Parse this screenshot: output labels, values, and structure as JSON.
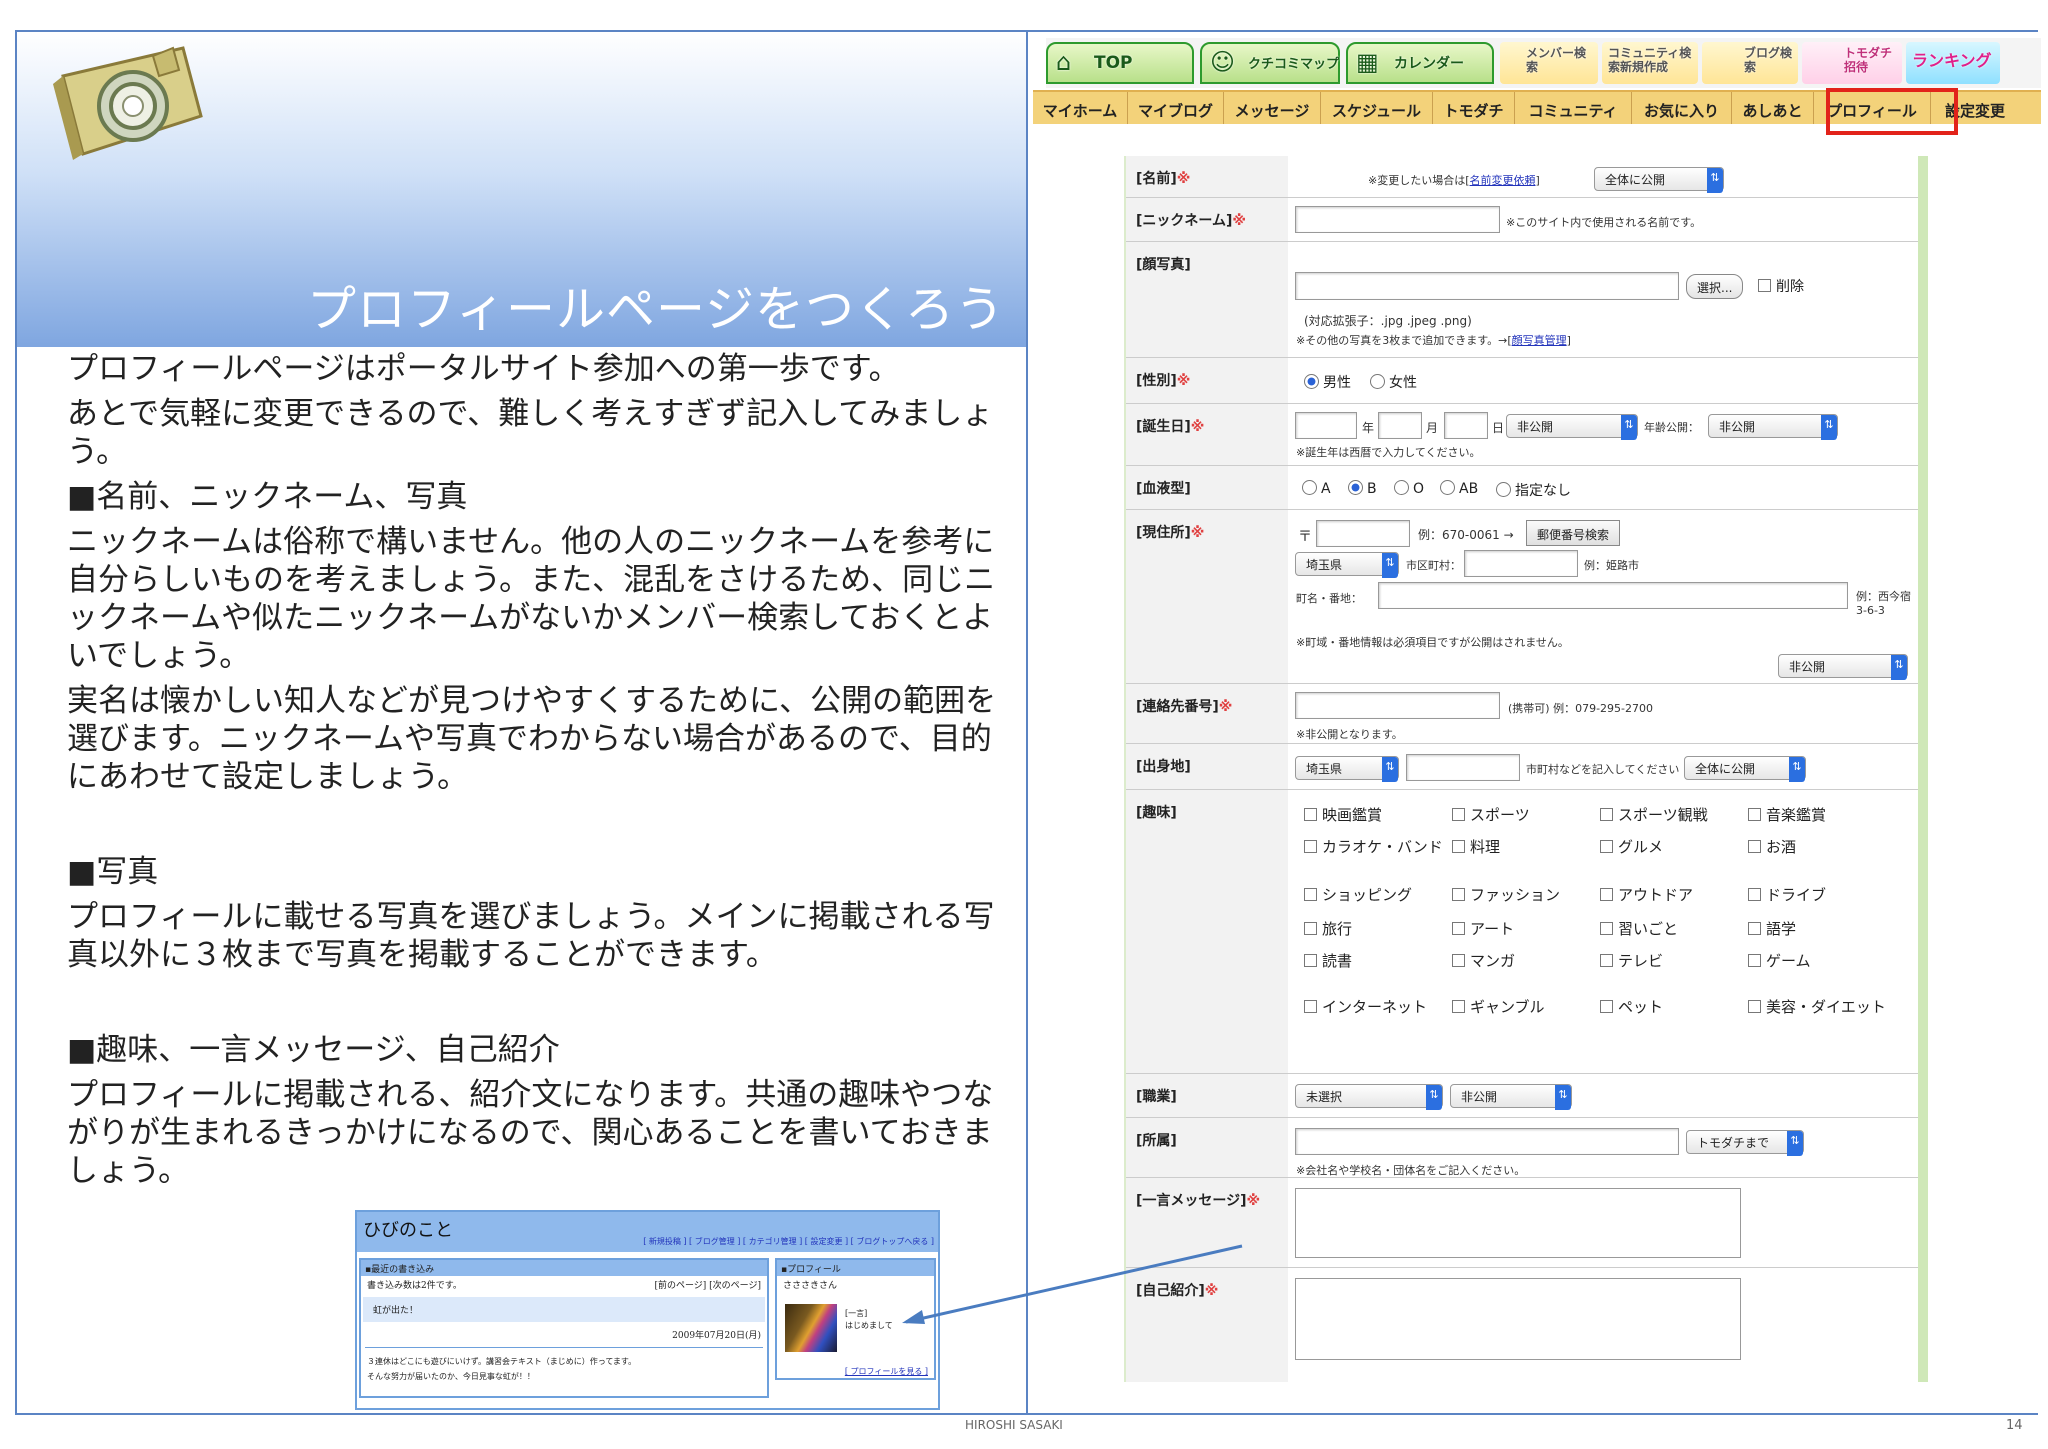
{
  "slide": {
    "title": "プロフィールページをつくろう",
    "page_number": "14",
    "footer": "HIROSHI SASAKI"
  },
  "body": {
    "p1": "プロフィールページはポータルサイト参加への第一歩です。",
    "p2": "あとで気軽に変更できるので、難しく考えすぎず記入してみましょう。",
    "h1": "■名前、ニックネーム、写真",
    "p3": "ニックネームは俗称で構いません。他の人のニックネームを参考に自分らしいものを考えましょう。また、混乱をさけるため、同じニックネームや似たニックネームがないかメンバー検索しておくとよいでしょう。",
    "p4": "実名は懐かしい知人などが見つけやすくするために、公開の範囲を選びます。ニックネームや写真でわからない場合があるので、目的にあわせて設定しましょう。",
    "h2": "■写真",
    "p5": "プロフィールに載せる写真を選びましょう。メインに掲載される写真以外に３枚まで写真を掲載することができます。",
    "h3": "■趣味、一言メッセージ、自己紹介",
    "p6": "プロフィールに掲載される、紹介文になります。共通の趣味やつながりが生まれるきっかけになるので、関心あることを書いておきましょう。"
  },
  "mini": {
    "title": "ひびのこと",
    "links": "[ 新規投稿 ] [ ブログ管理 ] [ カテゴリ管理 ] [ 設定変更 ] [ ブログトップへ戻る ]",
    "recent_header": "▪最近の書き込み",
    "count_text": "書き込み数は2件です。",
    "pager": "[前のページ] [次のページ]",
    "entry_title": "虹が出た！",
    "entry_date": "2009年07月20日(月)",
    "entry_body1": "３連休はどこにも遊びにいけず。講習会テキスト（まじめに）作ってます。",
    "entry_body2": "そんな努力が届いたのか、今日見事な虹が！！",
    "profile_header": "▪プロフィール",
    "profile_name": "さささきさん",
    "profile_msg1": "[一言]",
    "profile_msg2": "はじめまして",
    "profile_link": "[ プロフィールを見る ]"
  },
  "topnav": [
    {
      "label": "TOP",
      "icon": "house-icon"
    },
    {
      "label": "クチコミマップ",
      "icon": "map-icon"
    },
    {
      "label": "カレンダー",
      "icon": "calendar-icon"
    },
    {
      "label": "メンバー検索",
      "icon": "member-icon"
    },
    {
      "label": "コミュニティ検索新規作成",
      "icon": "community-icon"
    },
    {
      "label": "ブログ検索",
      "icon": "blog-icon"
    },
    {
      "label": "トモダチ招待",
      "icon": "invite-icon"
    },
    {
      "label": "ランキング",
      "icon": "ranking-icon"
    }
  ],
  "subnav": [
    "マイホーム",
    "マイブログ",
    "メッセージ",
    "スケジュール",
    "トモダチ",
    "コミュニティ",
    "お気に入り",
    "あしあと",
    "プロフィール",
    "設定変更"
  ],
  "form": {
    "name": {
      "label": "[名前]",
      "note": "※変更したい場合は[",
      "link": "名前変更依頼",
      "note_end": "]",
      "visibility": "全体に公開"
    },
    "nickname": {
      "label": "[ニックネーム]",
      "note": "※このサイト内で使用される名前です。"
    },
    "photo": {
      "label": "[顔写真]",
      "choose": "選択...",
      "delete": "削除",
      "ext": "(対応拡張子：.jpg .jpeg .png)",
      "more": "※その他の写真を3枚まで追加できます。→[",
      "more_link": "顔写真管理",
      "more_end": "]"
    },
    "gender": {
      "label": "[性別]",
      "options": [
        "男性",
        "女性"
      ],
      "selected": "男性"
    },
    "birthday": {
      "label": "[誕生日]",
      "year": "年",
      "month": "月",
      "day": "日",
      "visibility": "非公開",
      "age_label": "年齢公開：",
      "age_visibility": "非公開",
      "note": "※誕生年は西暦で入力してください。"
    },
    "blood": {
      "label": "[血液型]",
      "options": [
        "A",
        "B",
        "O",
        "AB",
        "指定なし"
      ],
      "selected": "B"
    },
    "address": {
      "label": "[現住所]",
      "postal_mark": "〒",
      "postal_example": "例：670-0061 →",
      "postal_button": "郵便番号検索",
      "prefecture": "埼玉県",
      "city_label": "市区町村：",
      "city_example": "例：姫路市",
      "town_label": "町名・番地：",
      "town_example": "例：西今宿3-6-3",
      "note": "※町域・番地情報は必須項目ですが公開はされません。",
      "visibility": "非公開"
    },
    "phone": {
      "label": "[連絡先番号]",
      "example": "(携帯可) 例：079-295-2700",
      "note": "※非公開となります。"
    },
    "hometown": {
      "label": "[出身地]",
      "prefecture": "埼玉県",
      "note": "市町村などを記入してください",
      "visibility": "全体に公開"
    },
    "hobbies": {
      "label": "[趣味]",
      "items": [
        "映画鑑賞",
        "スポーツ",
        "スポーツ観戦",
        "音楽鑑賞",
        "カラオケ・バンド",
        "料理",
        "グルメ",
        "お酒",
        "ショッピング",
        "ファッション",
        "アウトドア",
        "ドライブ",
        "旅行",
        "アート",
        "習いごと",
        "語学",
        "読書",
        "マンガ",
        "テレビ",
        "ゲーム",
        "インターネット",
        "ギャンブル",
        "ペット",
        "美容・ダイエット"
      ]
    },
    "job": {
      "label": "[職業]",
      "value": "未選択",
      "visibility": "非公開"
    },
    "affiliation": {
      "label": "[所属]",
      "visibility": "トモダチまで",
      "note": "※会社名や学校名・団体名をご記入ください。"
    },
    "message": {
      "label": "[一言メッセージ]"
    },
    "intro": {
      "label": "[自己紹介]"
    }
  },
  "required_mark": "※",
  "colors": {
    "accent_blue": "#5b84c4",
    "highlight_red": "#e2231a",
    "nav_green": "#2d9a2d",
    "subnav_bg": "#f3d27a",
    "arrow": "#4a7cc0"
  }
}
